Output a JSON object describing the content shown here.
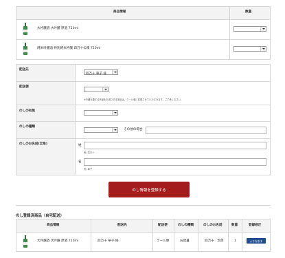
{
  "product_table": {
    "header_product": "商品情報",
    "header_qty": "数量",
    "rows": [
      {
        "name": "大吟醸酒 大吟醸 原酒 720ml"
      },
      {
        "name": "純米吟醸酒 特別純米吟醸 四万十の風 720ml"
      }
    ]
  },
  "form": {
    "delivery_label": "配送先",
    "delivery_value": "四万十 華子 様",
    "shipping_label": "配送便",
    "shipping_note": "※冷蔵を要する商品をお送りする場合は、クール便に変更させていただきます。ご了承ください。",
    "noshi_use_label": "のしの有無",
    "noshi_type_label": "のしの種類",
    "noshi_other_label": "その他の場合",
    "noshi_name_label": "のしのお名前(全角)",
    "surname_label": "姓",
    "surname_example": "例) 四万十",
    "given_label": "名",
    "given_example": "例) 華子"
  },
  "register_button": "のし情報を登録する",
  "registered": {
    "section_title": "のし登録済商品（自宅配送）",
    "headers": [
      "商品情報",
      "配送先",
      "配送便",
      "のしの種類",
      "のしのお名前",
      "数量",
      "登録修正"
    ],
    "rows": [
      {
        "name": "大吟醸酒 大吟醸 原酒 720ml",
        "delivery": "四万十 華子 様",
        "shipping": "クール便",
        "noshi_type": "お歳暮",
        "noshi_name": "四万十　太郎",
        "qty": "1",
        "action": "ふりなおす"
      }
    ]
  },
  "colors": {
    "accent_red": "#a41c1c",
    "action_blue": "#1f4b8f"
  }
}
